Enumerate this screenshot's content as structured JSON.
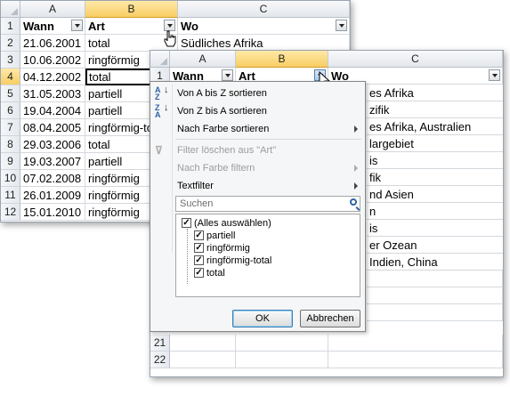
{
  "back_sheet": {
    "columns": [
      "A",
      "B",
      "C"
    ],
    "rows": [
      "1",
      "2",
      "3",
      "4",
      "5",
      "6",
      "7",
      "8",
      "9",
      "10",
      "11",
      "12"
    ],
    "header": [
      "Wann",
      "Art",
      "Wo"
    ],
    "data": [
      [
        "21.06.2001",
        "total",
        "Südliches Afrika"
      ],
      [
        "10.06.2002",
        "ringförmig",
        ""
      ],
      [
        "04.12.2002",
        "total",
        ""
      ],
      [
        "31.05.2003",
        "partiell",
        ""
      ],
      [
        "19.04.2004",
        "partiell",
        ""
      ],
      [
        "08.04.2005",
        "ringförmig-total",
        ""
      ],
      [
        "29.03.2006",
        "total",
        ""
      ],
      [
        "19.03.2007",
        "partiell",
        ""
      ],
      [
        "07.02.2008",
        "ringförmig",
        ""
      ],
      [
        "26.01.2009",
        "ringförmig",
        ""
      ],
      [
        "15.01.2010",
        "ringförmig",
        ""
      ],
      [
        "",
        "",
        ""
      ]
    ]
  },
  "front_sheet": {
    "columns": [
      "A",
      "B",
      "C"
    ],
    "rows": [
      "1",
      "21",
      "22"
    ],
    "header": [
      "Wann",
      "Art",
      "Wo"
    ],
    "wo_partial": [
      "es Afrika",
      "zifik",
      "es Afrika, Australien",
      "largebiet",
      "is",
      "fik",
      "nd Asien",
      "n",
      "is",
      "er Ozean",
      "Indien, China"
    ]
  },
  "filter_menu": {
    "sort_az": "Von A bis Z sortieren",
    "sort_za": "Von Z bis A sortieren",
    "sort_color": "Nach Farbe sortieren",
    "clear_filter": "Filter löschen aus \"Art\"",
    "filter_color": "Nach Farbe filtern",
    "text_filter": "Textfilter",
    "search_placeholder": "Suchen",
    "items": [
      "(Alles auswählen)",
      "partiell",
      "ringförmig",
      "ringförmig-total",
      "total"
    ],
    "ok": "OK",
    "cancel": "Abbrechen"
  },
  "icons": {
    "sort_az": "sort-ascending-icon",
    "sort_za": "sort-descending-icon",
    "clear_filter": "clear-filter-icon",
    "search": "search-icon",
    "cursor": "hand-cursor-icon"
  }
}
